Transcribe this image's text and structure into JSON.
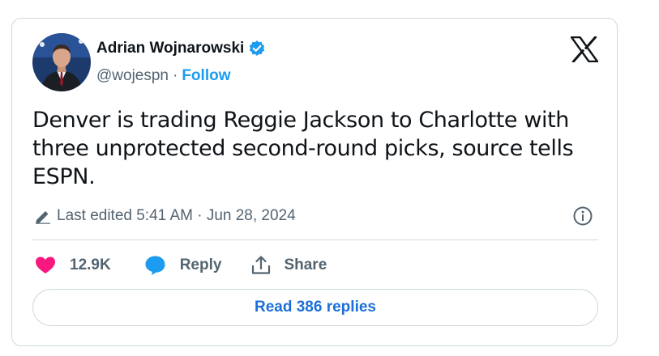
{
  "author": {
    "name": "Adrian Wojnarowski",
    "handle": "@wojespn",
    "separator": "·",
    "follow_label": "Follow"
  },
  "tweet": {
    "text": "Denver is trading Reggie Jackson to Charlotte with three unprotected second-round picks, source tells ESPN."
  },
  "edited_label": "Last edited 5:41 AM · Jun 28, 2024",
  "actions": {
    "likes_count": "12.9K",
    "reply_label": "Reply",
    "share_label": "Share"
  },
  "read_replies_label": "Read 386 replies",
  "colors": {
    "accent": "#1d9bf0",
    "like": "#f91880",
    "text": "#0f1419",
    "secondary": "#536471",
    "border": "#cfd9de"
  },
  "icons": [
    "avatar",
    "verified-badge-icon",
    "x-logo-icon",
    "pencil-icon",
    "info-icon",
    "heart-icon",
    "reply-bubble-icon",
    "share-icon"
  ]
}
